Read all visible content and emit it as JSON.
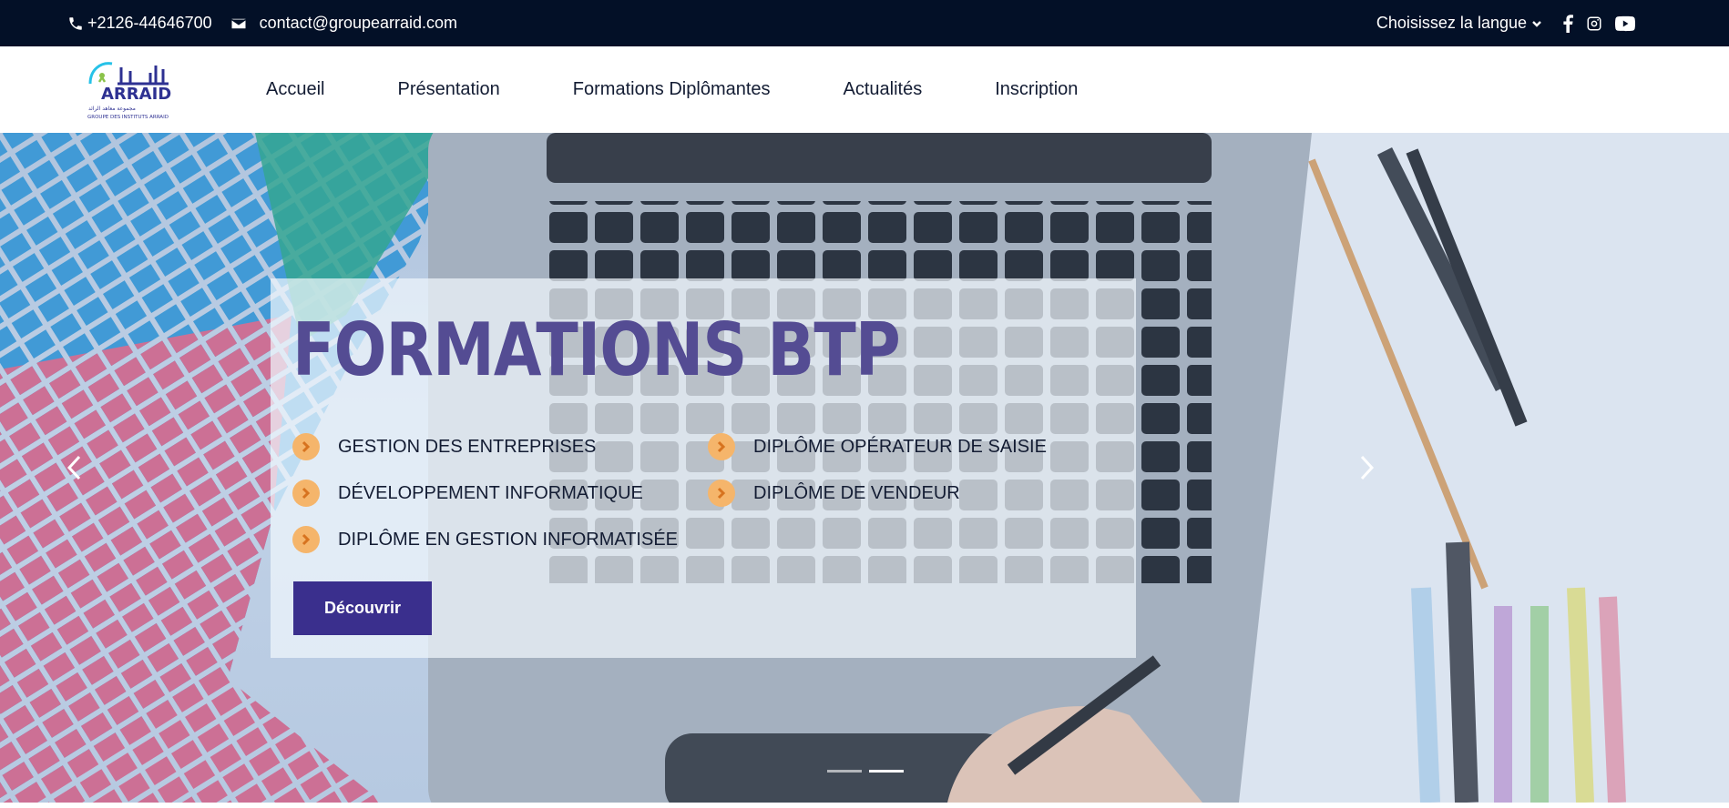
{
  "topbar": {
    "phone": "+2126-44646700",
    "email": "contact@groupearraid.com",
    "language_label": "Choisissez la langue",
    "social": [
      "facebook-icon",
      "instagram-icon",
      "youtube-icon"
    ]
  },
  "logo": {
    "name": "ARRAID",
    "arabic": "الرائد",
    "subtitle_ar": "مجموعة معاهد الرائد",
    "subtitle": "GROUPE DES INSTITUTS ARRAID"
  },
  "nav": {
    "items": [
      "Accueil",
      "Présentation",
      "Formations Diplômantes",
      "Actualités",
      "Inscription"
    ]
  },
  "hero": {
    "title": "FORMATIONS BTP",
    "items": [
      "GESTION DES ENTREPRISES",
      "DÉVELOPPEMENT INFORMATIQUE",
      "DIPLÔME EN GESTION INFORMATISÉE",
      "DIPLÔME OPÉRATEUR DE SAISIE",
      "DIPLÔME DE VENDEUR"
    ],
    "button": "Découvrir",
    "slides": 2,
    "active_slide": 2
  },
  "colors": {
    "topbar_bg": "#031027",
    "title": "#544c93",
    "button_bg": "#3a2f8d",
    "check": "#f5b56b"
  }
}
